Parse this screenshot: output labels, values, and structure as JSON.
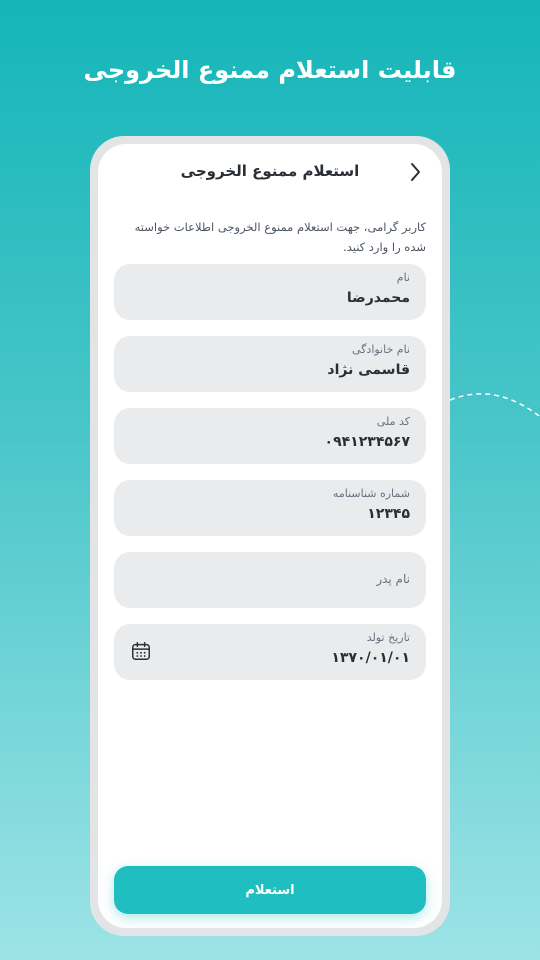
{
  "page": {
    "headline": "قابلیت استعلام ممنوع الخروجی"
  },
  "app": {
    "title": "استعلام ممنوع الخروجی",
    "intro": "کاربر گرامی، جهت استعلام ممنوع الخروجی اطلاعات خواسته شده را وارد کنید.",
    "fields": {
      "first_name": {
        "label": "نام",
        "value": "محمدرضا"
      },
      "last_name": {
        "label": "نام خانوادگی",
        "value": "قاسمی نژاد"
      },
      "national_code": {
        "label": "کد ملی",
        "value": "۰۹۴۱۲۳۴۵۶۷"
      },
      "id_number": {
        "label": "شماره شناسنامه",
        "value": "۱۲۳۴۵"
      },
      "father_name": {
        "label": "نام پدر",
        "value": ""
      },
      "birth_date": {
        "label": "تاریخ تولد",
        "value": "۱۳۷۰/۰۱/۰۱"
      }
    },
    "submit_label": "استعلام"
  },
  "icons": {
    "back": "chevron-right-icon",
    "calendar": "calendar-icon"
  },
  "colors": {
    "accent": "#1fbec1",
    "background_top": "#14b5b8",
    "background_bottom": "#9de3e6",
    "field_bg": "#e9ebed"
  }
}
